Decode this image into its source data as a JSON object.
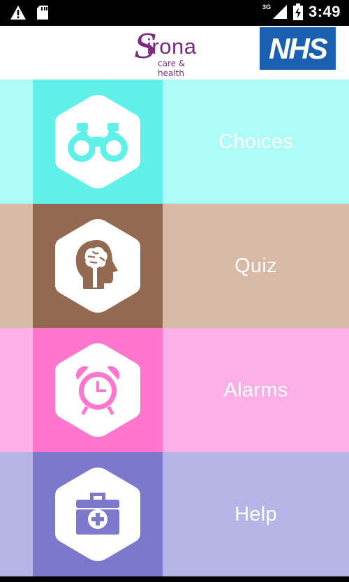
{
  "status_bar": {
    "time": "3:49",
    "network": "3G",
    "icons": [
      "warning-icon",
      "sd-card-icon",
      "signal-icon",
      "battery-icon"
    ]
  },
  "header": {
    "sirona_logo": {
      "name": "Sirona",
      "tagline": "care & health"
    },
    "nhs_logo": "NHS"
  },
  "menu": [
    {
      "label": "Choices",
      "icon": "binoculars-icon",
      "bg": "#aefcf8",
      "accent": "#5ff0e9"
    },
    {
      "label": "Quiz",
      "icon": "brain-head-icon",
      "bg": "#d8b9a6",
      "accent": "#946952"
    },
    {
      "label": "Alarms",
      "icon": "alarm-clock-icon",
      "bg": "#fbafe6",
      "accent": "#ff76cf"
    },
    {
      "label": "Help",
      "icon": "first-aid-kit-icon",
      "bg": "#b4b4e6",
      "accent": "#7c79cc"
    }
  ]
}
